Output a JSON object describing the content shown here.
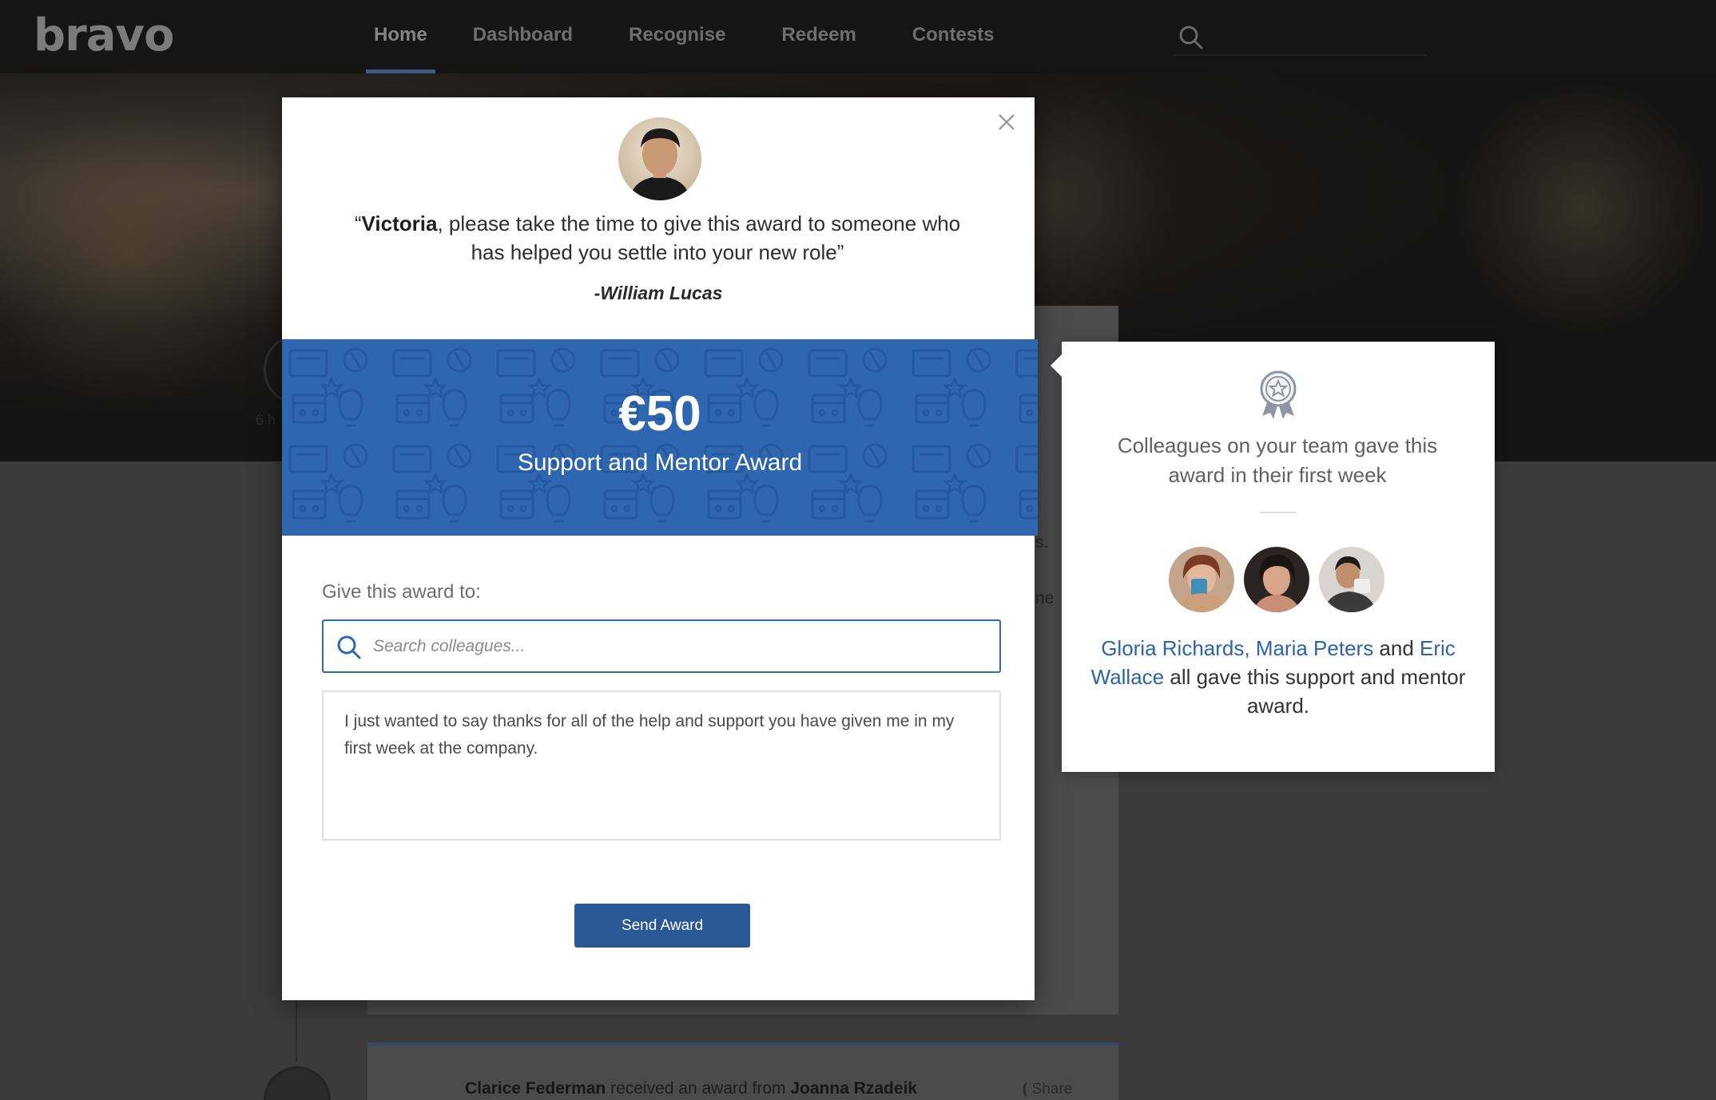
{
  "app": {
    "logo": "bravo"
  },
  "nav": {
    "items": [
      {
        "label": "Home",
        "active": true
      },
      {
        "label": "Dashboard",
        "active": false
      },
      {
        "label": "Recognise",
        "active": false
      },
      {
        "label": "Redeem",
        "active": false
      },
      {
        "label": "Contests",
        "active": false
      }
    ]
  },
  "background": {
    "feed_time": "6 h",
    "feed_actor": "Clarice Federman",
    "feed_action": " received an award from ",
    "feed_sender": "Joanna Rzadeik",
    "share_label": "Share",
    "frag_1": "s.",
    "frag_2": "ne"
  },
  "modal": {
    "quote_name": "Victoria",
    "quote_open": "“",
    "quote_rest": ", please take the time to give this award to someone who has helped you settle into your new role”",
    "author": "-William Lucas",
    "amount": "€50",
    "award_name": "Support and Mentor Award",
    "give_label": "Give this award to:",
    "search_placeholder": "Search colleagues...",
    "message": "I just wanted to say thanks for all of the help and support you have given me in my first week at the company.",
    "send_label": "Send Award"
  },
  "popover": {
    "title": "Colleagues on your team gave this award in their first week",
    "name_1": "Gloria Richards",
    "sep": ", ",
    "name_2": "Maria Peters",
    "and": " and ",
    "name_3": "Eric Wallace",
    "tail": " all gave this support and mentor award."
  },
  "colors": {
    "accent": "#2e67b0",
    "button": "#2a5897",
    "link": "#2a64ab"
  }
}
